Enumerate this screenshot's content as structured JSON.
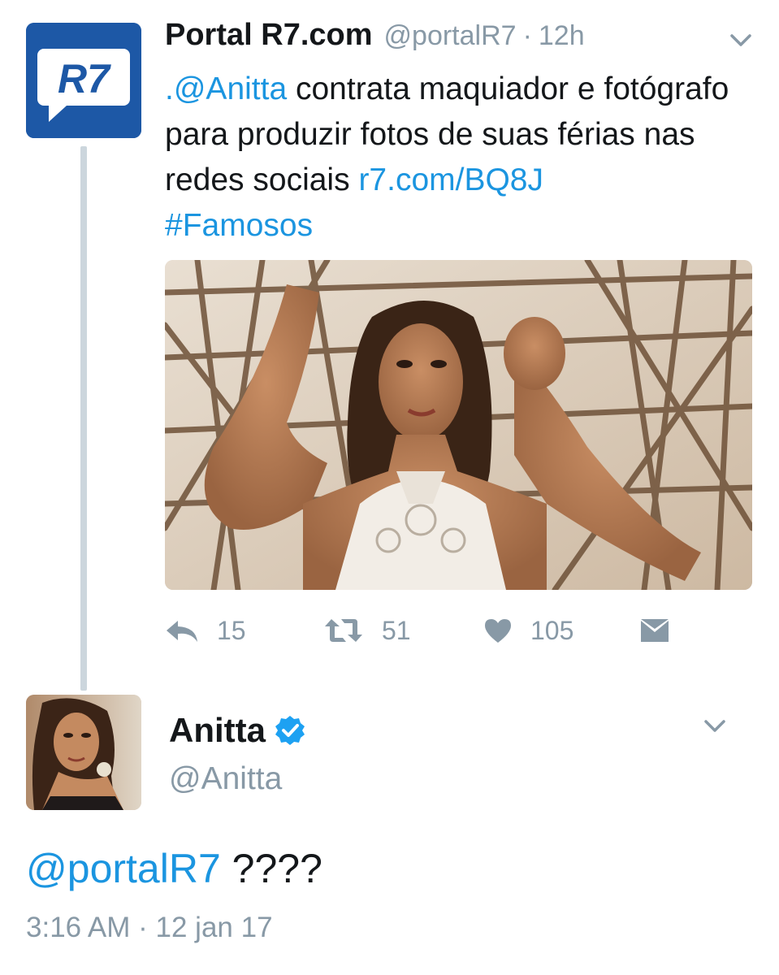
{
  "tweet1": {
    "author_name": "Portal R7.com",
    "author_handle": "@portalR7",
    "separator": "·",
    "time_ago": "12h",
    "avatar_text": "R7",
    "text_mention": ".@Anitta",
    "text_body": " contrata maquiador e fotógrafo para produzir fotos de suas férias nas redes sociais ",
    "text_link": "r7.com/BQ8J",
    "text_hashtag": "#Famosos",
    "actions": {
      "reply_count": "15",
      "retweet_count": "51",
      "like_count": "105"
    },
    "media_icon": "photo-of-woman-among-branches"
  },
  "tweet2": {
    "author_name": "Anitta",
    "author_handle": "@Anitta",
    "verified_icon": "verified-badge-icon",
    "reply_mention": "@portalR7",
    "reply_text": " ????",
    "timestamp": "3:16 AM · 12 jan 17"
  },
  "colors": {
    "link": "#1b95e0",
    "muted": "#8899a6",
    "text": "#14171a",
    "thread_line": "#ccd6dd",
    "r7_brand": "#1d58a6"
  }
}
